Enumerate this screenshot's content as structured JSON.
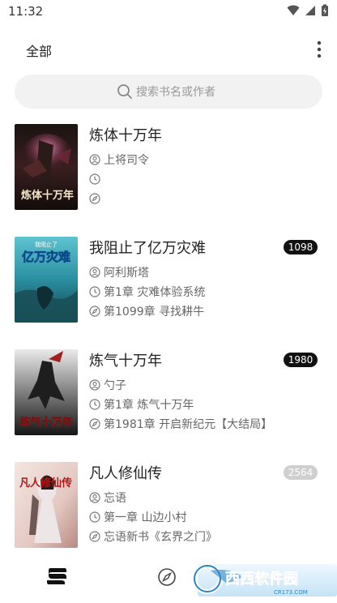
{
  "status": {
    "time": "11:32"
  },
  "header": {
    "title": "全部"
  },
  "search": {
    "placeholder": "搜索书名或作者"
  },
  "books": [
    {
      "title": "炼体十万年",
      "author": "上将司令",
      "latest_read": "",
      "latest_chapter": "",
      "badge": ""
    },
    {
      "title": "我阻止了亿万灾难",
      "author": "阿利斯塔",
      "latest_read": "第1章 灾难体验系统",
      "latest_chapter": "第1099章 寻找耕牛",
      "badge": "1098"
    },
    {
      "title": "炼气十万年",
      "author": "勺子",
      "latest_read": "第1章 炼气十万年",
      "latest_chapter": "第1981章 开启新纪元【大结局】",
      "badge": "1980"
    },
    {
      "title": "凡人修仙传",
      "author": "忘语",
      "latest_read": "第一章 山边小村",
      "latest_chapter": "忘语新书《玄界之门》",
      "badge": "2564"
    }
  ],
  "covers": [
    {
      "text": "炼体十万年"
    },
    {
      "small_text": "我阻止了",
      "text": "亿万灾难"
    },
    {
      "text": "炼气十万年"
    },
    {
      "text": "凡人修仙传"
    }
  ],
  "watermark": {
    "brand": "西西软件园",
    "url": "CR173.COM"
  },
  "colors": {
    "badge_active": "#111111",
    "badge_inactive": "#cfcfcf",
    "search_bg": "#f2f2f2"
  }
}
